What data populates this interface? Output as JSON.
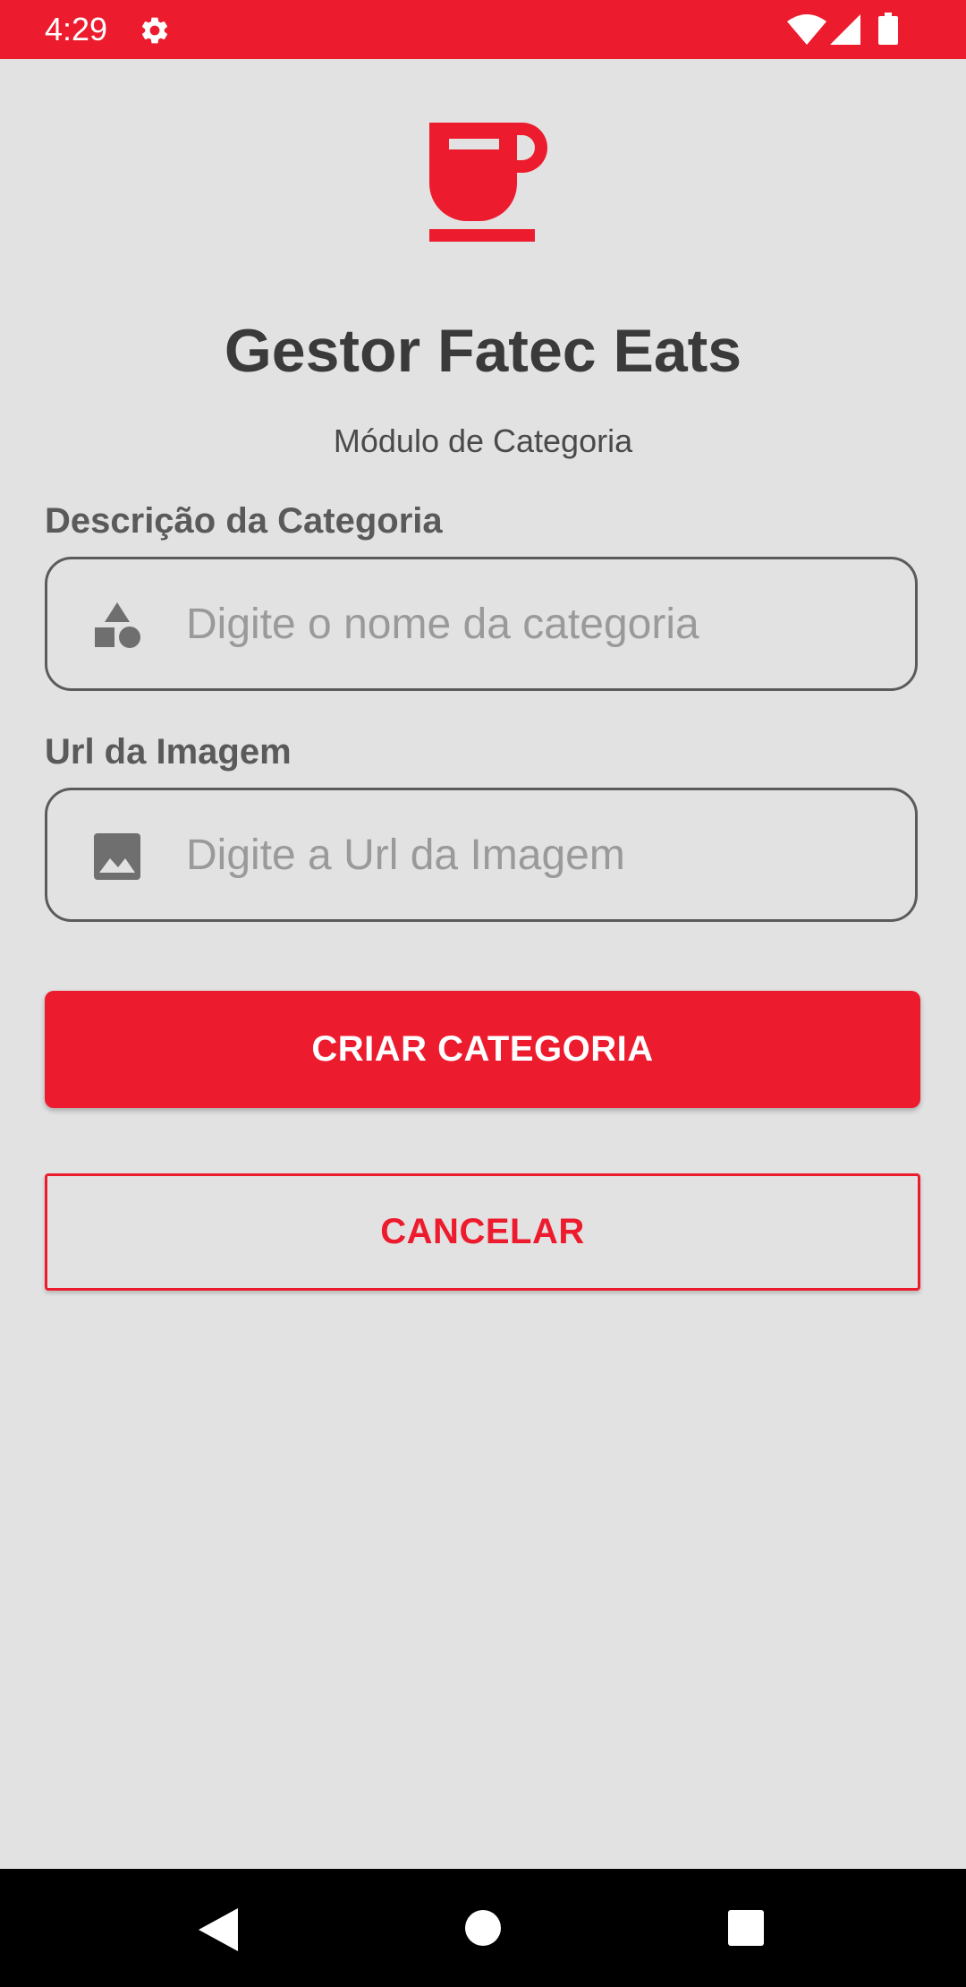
{
  "status_bar": {
    "time": "4:29",
    "icons": [
      "settings-gear-icon",
      "wifi-icon",
      "cell-signal-icon",
      "battery-icon"
    ],
    "background_color": "#ec1c2e"
  },
  "logo": {
    "icon": "coffee-cup-icon",
    "color": "#ec1c2e"
  },
  "header": {
    "title": "Gestor Fatec Eats",
    "subtitle": "Módulo de Categoria"
  },
  "form": {
    "description": {
      "label": "Descrição da Categoria",
      "placeholder": "Digite o nome da categoria",
      "value": "",
      "icon": "category-shapes-icon"
    },
    "image_url": {
      "label": "Url da Imagem",
      "placeholder": "Digite a Url da Imagem",
      "value": "",
      "icon": "image-icon"
    }
  },
  "actions": {
    "create_label": "CRIAR CATEGORIA",
    "cancel_label": "CANCELAR"
  },
  "colors": {
    "accent": "#ec1c2e",
    "background": "#e2e2e2",
    "text_dark": "#3a3a3a"
  },
  "nav_bar": {
    "icons": [
      "back-icon",
      "home-icon",
      "recents-icon"
    ]
  }
}
